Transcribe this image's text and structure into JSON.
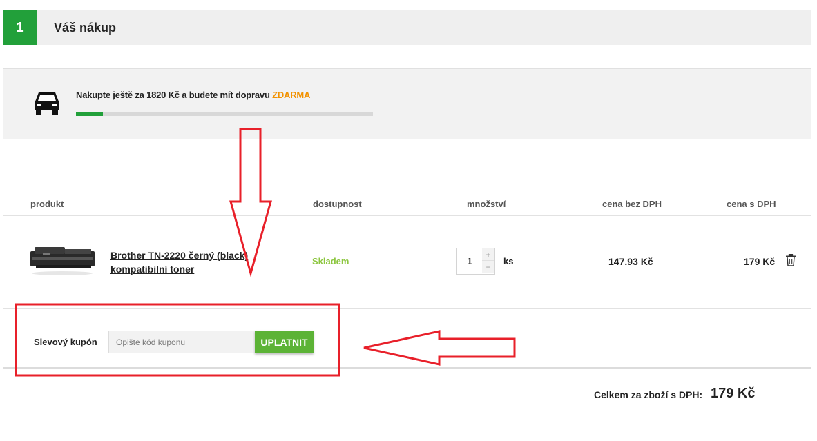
{
  "step": {
    "number": "1",
    "title": "Váš nákup"
  },
  "shipping": {
    "text": "Nakupte ještě za 1820 Kč a budete mít dopravu ",
    "free": "ZDARMA",
    "progress": 0.09,
    "icon": "car-icon"
  },
  "table": {
    "headers": {
      "product": "produkt",
      "availability": "dostupnost",
      "quantity": "množství",
      "price_ex_vat": "cena bez DPH",
      "price_inc_vat": "cena s DPH"
    },
    "rows": [
      {
        "name": "Brother TN-2220 černý (black) kompatibilní toner",
        "availability": "Skladem",
        "quantity": "1",
        "unit": "ks",
        "qty_plus": "+",
        "qty_minus": "−",
        "price_ex_vat": "147.93 Kč",
        "price_inc_vat": "179 Kč"
      }
    ]
  },
  "coupon": {
    "label": "Slevový kupón",
    "placeholder": "Opište kód kuponu",
    "button": "UPLATNIT"
  },
  "summary": {
    "label": "Celkem za zboží s DPH:",
    "total": "179 Kč"
  },
  "colors": {
    "green": "#22a03a",
    "button_green": "#5cb336",
    "stock_green": "#8cc63f",
    "orange": "#f29200",
    "annotation_red": "#e8202a"
  }
}
